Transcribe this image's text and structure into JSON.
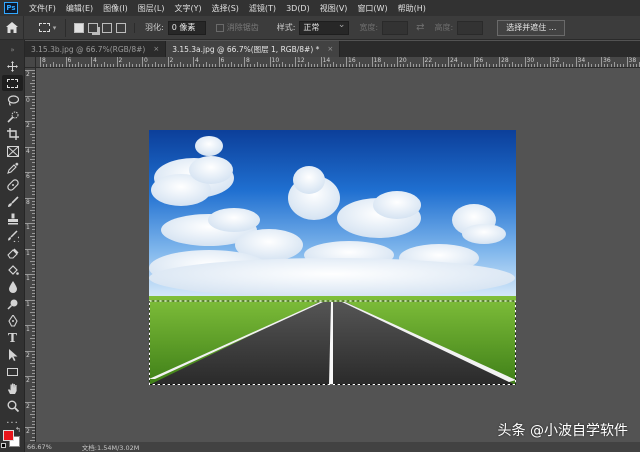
{
  "app": {
    "logo": "Ps"
  },
  "menu": [
    "文件(F)",
    "编辑(E)",
    "图像(I)",
    "图层(L)",
    "文字(Y)",
    "选择(S)",
    "滤镜(T)",
    "3D(D)",
    "视图(V)",
    "窗口(W)",
    "帮助(H)"
  ],
  "options": {
    "feather_label": "羽化:",
    "feather_value": "0 像素",
    "antialias_label": "消除锯齿",
    "style_label": "样式:",
    "style_value": "正常",
    "width_label": "宽度:",
    "height_label": "高度:",
    "select_mask_button": "选择并遮住 ..."
  },
  "tabs": [
    {
      "label": "3.15.3b.jpg @ 66.7%(RGB/8#)",
      "close": "×"
    },
    {
      "label": "3.15.3a.jpg @ 66.7%(图层 1, RGB/8#) *",
      "close": "×"
    }
  ],
  "ruler_h_labels": [
    "8",
    "6",
    "4",
    "2",
    "0",
    "2",
    "4",
    "6",
    "8",
    "10",
    "12",
    "14",
    "16",
    "18",
    "20",
    "22",
    "24",
    "26",
    "28",
    "30",
    "32",
    "34",
    "36",
    "38"
  ],
  "ruler_v_labels": [
    "2",
    "0",
    "2",
    "4",
    "6",
    "8",
    "1",
    "1",
    "1",
    "1",
    "1",
    "2",
    "2",
    "2",
    "2"
  ],
  "status": {
    "zoom": "66.67%",
    "doc": "文档:1.54M/3.02M"
  },
  "colors": {
    "foreground": "#e8141a",
    "background": "#ffffff",
    "accent": "#31a8ff"
  },
  "watermark": "头条 @小波自学软件",
  "icons": [
    "home-icon",
    "marquee-icon",
    "move-icon",
    "lasso-icon",
    "quick-select-icon",
    "crop-icon",
    "frame-icon",
    "eyedropper-icon",
    "healing-icon",
    "brush-icon",
    "stamp-icon",
    "history-brush-icon",
    "eraser-icon",
    "paint-bucket-icon",
    "blur-icon",
    "dodge-icon",
    "pen-icon",
    "type-icon",
    "path-select-icon",
    "rectangle-icon",
    "hand-icon",
    "zoom-icon",
    "more-icon"
  ]
}
